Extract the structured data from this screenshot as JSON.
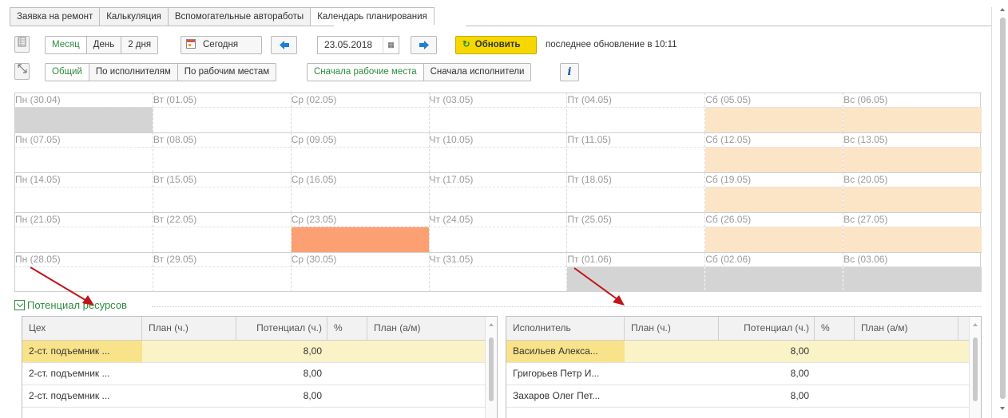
{
  "tabs": [
    "Заявка на ремонт",
    "Калькуляция",
    "Вспомогательные автоработы",
    "Календарь планирования"
  ],
  "toolbar": {
    "period": [
      "Месяц",
      "День",
      "2 дня"
    ],
    "today": "Сегодня",
    "date_value": "23.05.2018",
    "refresh": "Обновить",
    "last_update": "последнее обновление в 10:11",
    "view_modes": [
      "Общий",
      "По исполнителям",
      "По рабочим местам"
    ],
    "order_modes": [
      "Сначала рабочие места",
      "Сначала исполнители"
    ],
    "info": "i"
  },
  "calendar": {
    "weeks": [
      [
        "Пн (30.04)",
        "Вт (01.05)",
        "Ср (02.05)",
        "Чт (03.05)",
        "Пт (04.05)",
        "Сб (05.05)",
        "Вс (06.05)"
      ],
      [
        "Пн (07.05)",
        "Вт (08.05)",
        "Ср (09.05)",
        "Чт (10.05)",
        "Пт (11.05)",
        "Сб (12.05)",
        "Вс (13.05)"
      ],
      [
        "Пн (14.05)",
        "Вт (15.05)",
        "Ср (16.05)",
        "Чт (17.05)",
        "Пт (18.05)",
        "Сб (19.05)",
        "Вс (20.05)"
      ],
      [
        "Пн (21.05)",
        "Вт (22.05)",
        "Ср (23.05)",
        "Чт (24.05)",
        "Пт (25.05)",
        "Сб (26.05)",
        "Вс (27.05)"
      ],
      [
        "Пн (28.05)",
        "Вт (29.05)",
        "Ср (30.05)",
        "Чт (31.05)",
        "Пт (01.06)",
        "Сб (02.06)",
        "Вс (03.06)"
      ]
    ],
    "colors": {
      "gray": "#d4d4d4",
      "weekend": "#fce5c7",
      "busy": "#fca073"
    }
  },
  "section": {
    "title": "Потенциал ресурсов"
  },
  "workshops": {
    "headers": [
      "Цех",
      "План (ч.)",
      "Потенциал (ч.)",
      "%",
      "План (а/м)"
    ],
    "rows": [
      [
        "2-ст. подъемник ...",
        "",
        "8,00",
        "",
        ""
      ],
      [
        "2-ст. подъемник ...",
        "",
        "8,00",
        "",
        ""
      ],
      [
        "2-ст. подъемник ...",
        "",
        "8,00",
        "",
        ""
      ]
    ]
  },
  "performers": {
    "headers": [
      "Исполнитель",
      "План (ч.)",
      "Потенциал (ч.)",
      "%",
      "План (а/м)"
    ],
    "rows": [
      [
        "Васильев Алекса...",
        "",
        "8,00",
        "",
        ""
      ],
      [
        "Григорьев Петр И...",
        "",
        "8,00",
        "",
        ""
      ],
      [
        "Захаров Олег Пет...",
        "",
        "8,00",
        "",
        ""
      ]
    ]
  },
  "annotation_color": "#c0151b"
}
